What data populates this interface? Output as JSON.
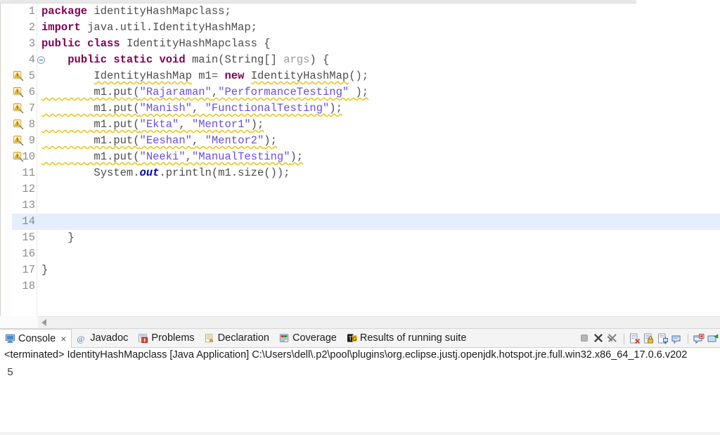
{
  "window": {
    "app": "Eclipse IDE"
  },
  "editor": {
    "current_line": 14,
    "lines": [
      {
        "n": "1",
        "marker": "none",
        "fold": false,
        "text_html": "<span class=\"kw\">package</span> <span class=\"pln\">identityHashMapclass;</span>"
      },
      {
        "n": "2",
        "marker": "none",
        "fold": false,
        "text_html": "<span class=\"kw\">import</span> <span class=\"pln\">java.util.IdentityHashMap;</span>"
      },
      {
        "n": "3",
        "marker": "none",
        "fold": false,
        "text_html": "<span class=\"kw\">public class</span> <span class=\"pln\">IdentityHashMapclass {</span>"
      },
      {
        "n": "4",
        "marker": "none",
        "fold": true,
        "text_html": "<span class=\"pln\">    </span><span class=\"kw\">public static void</span> <span class=\"pln\">main(String[] </span><span class=\"arg\">args</span><span class=\"pln\">) {</span>"
      },
      {
        "n": "5",
        "marker": "warning",
        "fold": false,
        "text_html": "<span class=\"pln\">        </span><span class=\"pln sq\">IdentityHashMap</span><span class=\"pln\"> m1= </span><span class=\"kw\">new</span> <span class=\"pln sq\">IdentityHashMap</span><span class=\"pln\">();</span>"
      },
      {
        "n": "6",
        "marker": "warning",
        "fold": false,
        "text_html": "<span class=\"pln sq\">        m1.put(</span><span class=\"strv sq\">\"Rajaraman\"</span><span class=\"pln sq\">,</span><span class=\"strv sq\">\"PerformanceTesting\"</span><span class=\"pln sq\"> );</span>"
      },
      {
        "n": "7",
        "marker": "warning",
        "fold": false,
        "text_html": "<span class=\"pln sq\">        m1.put(</span><span class=\"strv sq\">\"Manish\"</span><span class=\"pln sq\">, </span><span class=\"strv sq\">\"FunctionalTesting\"</span><span class=\"pln sq\">);</span>"
      },
      {
        "n": "8",
        "marker": "warning",
        "fold": false,
        "text_html": "<span class=\"pln sq\">        m1.put(</span><span class=\"strv sq\">\"Ekta\"</span><span class=\"pln sq\">, </span><span class=\"strv sq\">\"Mentor1\"</span><span class=\"pln sq\">);</span>"
      },
      {
        "n": "9",
        "marker": "warning",
        "fold": false,
        "text_html": "<span class=\"pln sq\">        m1.put(</span><span class=\"strv sq\">\"Eeshan\"</span><span class=\"pln sq\">, </span><span class=\"strv sq\">\"Mentor2\"</span><span class=\"pln sq\">);</span>"
      },
      {
        "n": "10",
        "marker": "warning",
        "fold": false,
        "text_html": "<span class=\"pln sq\">        m1.put(</span><span class=\"strv sq\">\"Neeki\"</span><span class=\"pln sq\">,</span><span class=\"strv sq\">\"ManualTesting\"</span><span class=\"pln sq\">);</span>"
      },
      {
        "n": "11",
        "marker": "none",
        "fold": false,
        "text_html": "<span class=\"pln\">        System.</span><span class=\"fld\">out</span><span class=\"pln\">.println(m1.size());</span>"
      },
      {
        "n": "12",
        "marker": "none",
        "fold": false,
        "text_html": ""
      },
      {
        "n": "13",
        "marker": "none",
        "fold": false,
        "text_html": ""
      },
      {
        "n": "14",
        "marker": "none",
        "fold": false,
        "text_html": ""
      },
      {
        "n": "15",
        "marker": "none",
        "fold": false,
        "text_html": "<span class=\"pln\">    }</span>"
      },
      {
        "n": "16",
        "marker": "none",
        "fold": false,
        "text_html": ""
      },
      {
        "n": "17",
        "marker": "none",
        "fold": false,
        "text_html": "<span class=\"pln\">}</span>"
      },
      {
        "n": "18",
        "marker": "none",
        "fold": false,
        "text_html": ""
      }
    ],
    "plain_text": [
      "package identityHashMapclass;",
      "import java.util.IdentityHashMap;",
      "public class IdentityHashMapclass {",
      "    public static void main(String[] args) {",
      "        IdentityHashMap m1= new IdentityHashMap();",
      "        m1.put(\"Rajaraman\",\"PerformanceTesting\" );",
      "        m1.put(\"Manish\", \"FunctionalTesting\");",
      "        m1.put(\"Ekta\", \"Mentor1\");",
      "        m1.put(\"Eeshan\", \"Mentor2\");",
      "        m1.put(\"Neeki\",\"ManualTesting\");",
      "        System.out.println(m1.size());",
      "",
      "",
      "",
      "    }",
      "",
      "}",
      ""
    ],
    "scrollbar": {
      "left_arrow_icon": "scroll-left-arrow"
    }
  },
  "console": {
    "tabs": [
      {
        "label": "Console",
        "icon": "console-icon",
        "active": true,
        "closable": true
      },
      {
        "label": "Javadoc",
        "icon": "javadoc-icon",
        "active": false,
        "closable": false
      },
      {
        "label": "Problems",
        "icon": "problems-icon",
        "active": false,
        "closable": false
      },
      {
        "label": "Declaration",
        "icon": "declaration-icon",
        "active": false,
        "closable": false
      },
      {
        "label": "Coverage",
        "icon": "coverage-icon",
        "active": false,
        "closable": false
      },
      {
        "label": "Results of running suite",
        "icon": "testng-icon",
        "active": false,
        "closable": false
      }
    ],
    "close_glyph": "×",
    "toolbar": [
      {
        "name": "terminate-button",
        "icon": "stop-square-icon"
      },
      {
        "name": "remove-launch-button",
        "icon": "remove-x-icon"
      },
      {
        "name": "remove-all-launches-button",
        "icon": "remove-all-x-icon"
      },
      {
        "name": "clear-console-button",
        "icon": "clear-console-icon"
      },
      {
        "name": "scroll-lock-button",
        "icon": "scroll-lock-icon"
      },
      {
        "name": "pin-console-button",
        "icon": "pin-console-icon"
      },
      {
        "name": "display-selected-console-button",
        "icon": "display-console-icon"
      },
      {
        "name": "open-console-button",
        "icon": "open-console-icon"
      },
      {
        "name": "new-console-view-button",
        "icon": "new-console-view-icon"
      }
    ],
    "launch_label": "<terminated> IdentityHashMapclass [Java Application] C:\\Users\\dell\\.p2\\pool\\plugins\\org.eclipse.justj.openjdk.hotspot.jre.full.win32.x86_64_17.0.6.v202",
    "output": "5"
  },
  "colors": {
    "keyword": "#7f0055",
    "string": "#2a00ff",
    "field": "#0000c0",
    "warning_squiggle": "#e8c51a",
    "annotation_bar": "#4a90e2",
    "current_line_highlight": "#e4effb",
    "tabbar_bg": "#f4f4f4"
  }
}
